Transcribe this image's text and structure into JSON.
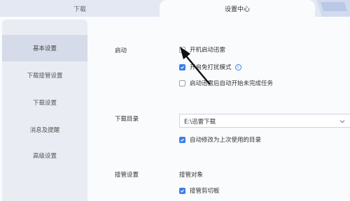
{
  "tabs": {
    "downloads": "下载",
    "settings": "设置中心"
  },
  "sidebar": {
    "items": [
      {
        "label": "基本设置",
        "active": true
      },
      {
        "label": "下载接管设置",
        "active": false
      },
      {
        "label": "下载设置",
        "active": false
      },
      {
        "label": "消息及提醒",
        "active": false
      },
      {
        "label": "高级设置",
        "active": false
      }
    ]
  },
  "startup": {
    "label": "启动",
    "options": [
      {
        "label": "开机启动迅雷",
        "checked": false
      },
      {
        "label": "开启免打扰模式",
        "checked": true,
        "info": "i"
      },
      {
        "label": "启动迅雷后自动开始未完成任务",
        "checked": false
      }
    ]
  },
  "download_dir": {
    "label": "下载目录",
    "value": "E:\\迅雷下载",
    "auto_change_label": "自动修改为上次使用的目录",
    "auto_change_checked": true
  },
  "takeover": {
    "label": "接管设置",
    "object_label": "接管对象",
    "clipboard_label": "接管剪切板",
    "clipboard_checked": true
  },
  "colors": {
    "accent": "#3b7ee6",
    "sidebar_bg": "#e9ecf3",
    "active_item": "#d5dbe8"
  }
}
